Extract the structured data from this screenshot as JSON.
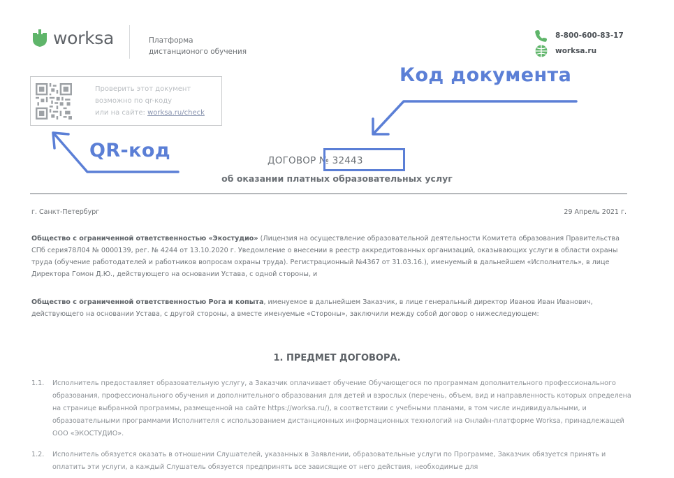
{
  "header": {
    "logo_text": "worksa",
    "platform_line1": "Платформа",
    "platform_line2": "дистанционого обучения",
    "phone": "8-800-600-83-17",
    "website": "worksa.ru",
    "brand_color": "#5fb56a"
  },
  "qr_block": {
    "line1": "Проверить этот документ",
    "line2": "возможно по qr-коду",
    "line3_prefix": "или на сайте: ",
    "link": "worksa.ru/check"
  },
  "callouts": {
    "doc_code": "Код документа",
    "qr_code": "QR-код",
    "accent_color": "#5b7fd6"
  },
  "document": {
    "title_prefix": "ДОГОВОР № 32443",
    "subtitle": "об оказании платных образовательных услуг",
    "city": "г. Санкт-Петербург",
    "date": "29 Апрель 2021 г.",
    "party1_name": "Общество с ограниченной ответственностью «Экостудио»",
    "party1_text": " (Лицензия на осуществление образовательной деятельности Комитета образования Правительства СПб серия78Л04 № 0000139, рег. № 4244 от 13.10.2020 г. Уведомление о внесении в реестр аккредитованных организаций, оказывающих услуги в области охраны труда (обучение работодателей и работников вопросам охраны труда). Регистрационный №4367 от 31.03.16.), именуемый в дальнейшем «Исполнитель», в лице Директора Гомон Д.Ю., действующего на основании Устава, с одной стороны, и",
    "party2_name": "Общество с ограниченной ответственностью Рога и копыта",
    "party2_text": ", именуемое в дальнейшем Заказчик, в лице генеральный директор Иванов Иван Иванович, действующего на основании Устава, с другой стороны, а вместе именуемые «Стороны», заключили между собой договор о нижеследующем:",
    "section_title": "1. ПРЕДМЕТ ДОГОВОРА.",
    "items": [
      {
        "num": "1.1.",
        "text": "Исполнитель предоставляет образовательную услугу, а Заказчик оплачивает обучение Обучающегося по программам дополнительного профессионального образования, профессионального обучения и дополнительного образования для детей и взрослых (перечень, объем, вид и направленность которых определена на странице выбранной программы, размещенной на сайте https://worksa.ru/), в соответствии с учебными планами, в том числе индивидуальными, и образовательными программами Исполнителя с использованием дистанционных информационных технологий на Онлайн-платформе Worksa, принадлежащей ООО «ЭКОСТУДИО»."
      },
      {
        "num": "1.2.",
        "text": "Исполнитель обязуется оказать в отношении Слушателей, указанных в Заявлении, образовательные услуги по Программе, Заказчик обязуется принять и оплатить эти услуги, а каждый Слушатель обязуется предпринять все зависящие от него действия, необходимые для"
      }
    ]
  }
}
